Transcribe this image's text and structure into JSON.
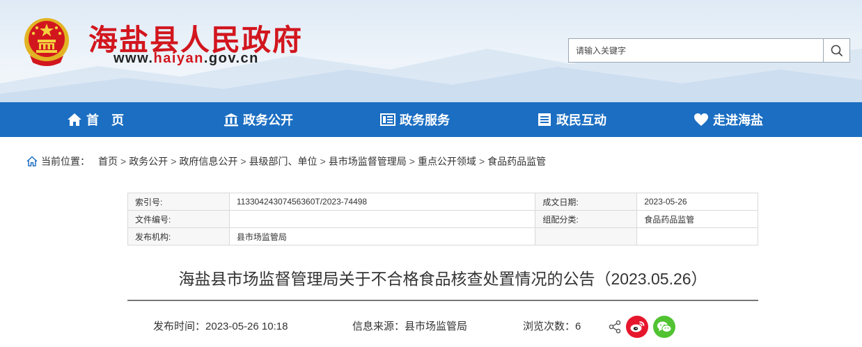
{
  "header": {
    "site_title": "海盐县人民政府",
    "site_url_prefix": "www.",
    "site_url_highlight": "haiyan",
    "site_url_suffix": ".gov.cn",
    "search": {
      "placeholder": "请输入关键字"
    }
  },
  "nav": {
    "items": [
      {
        "label": "首　页",
        "icon": "home-icon"
      },
      {
        "label": "政务公开",
        "icon": "building-icon"
      },
      {
        "label": "政务服务",
        "icon": "service-icon"
      },
      {
        "label": "政民互动",
        "icon": "list-icon"
      },
      {
        "label": "走进海盐",
        "icon": "heart-icon"
      }
    ]
  },
  "breadcrumb": {
    "lead": "当前位置：",
    "items": [
      "首页",
      "政务公开",
      "政府信息公开",
      "县级部门、单位",
      "县市场监督管理局",
      "重点公开领域",
      "食品药品监管"
    ],
    "separator": ">"
  },
  "meta": {
    "index_label": "索引号:",
    "index_value": "11330424307456360T/2023-74498",
    "date_label": "成文日期:",
    "date_value": "2023-05-26",
    "docno_label": "文件编号:",
    "docno_value": "",
    "category_label": "组配分类:",
    "category_value": "食品药品监管",
    "publisher_label": "发布机构:",
    "publisher_value": "县市场监管局"
  },
  "article": {
    "title": "海盐县市场监督管理局关于不合格食品核查处置情况的公告（2023.05.26）",
    "publish_time_label": "发布时间：",
    "publish_time": "2023-05-26 10:18",
    "source_label": "信息来源：",
    "source": "县市场监管局",
    "views_label": "浏览次数：",
    "views": "6"
  },
  "colors": {
    "brand_red": "#d2161e",
    "nav_blue": "#1b6ec2",
    "weibo_red": "#e6162d",
    "wechat_green": "#51c332"
  }
}
